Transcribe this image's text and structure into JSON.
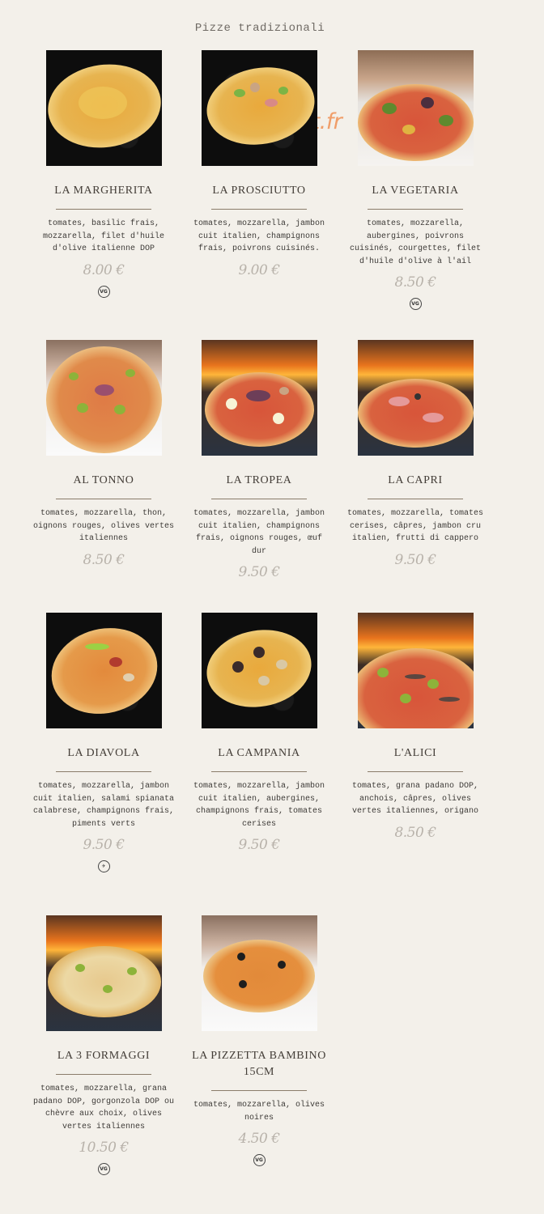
{
  "section_title": "Pizze tradizionali",
  "watermark": "list.fr",
  "pizzas": [
    {
      "name": "La Margherita",
      "description": "tomates, basilic frais, mozzarella, filet d'huile d'olive italienne DOP",
      "price": "8.00 €",
      "badge": "VG"
    },
    {
      "name": "La Prosciutto",
      "description": "tomates, mozzarella, jambon cuit italien, champignons frais, poivrons cuisinés.",
      "price": "9.00 €",
      "badge": ""
    },
    {
      "name": "La Vegetaria",
      "description": "tomates, mozzarella, aubergines, poivrons cuisinés, courgettes, filet d'huile d'olive à l'ail",
      "price": "8.50 €",
      "badge": "VG"
    },
    {
      "name": "Al Tonno",
      "description": "tomates, mozzarella, thon, oignons rouges, olives vertes italiennes",
      "price": "8.50 €",
      "badge": ""
    },
    {
      "name": "La Tropea",
      "description": "tomates, mozzarella, jambon cuit italien, champignons frais, oignons rouges, œuf dur",
      "price": "9.50 €",
      "badge": ""
    },
    {
      "name": "La Capri",
      "description": "tomates, mozzarella, tomates cerises, câpres, jambon cru italien, frutti di cappero",
      "price": "9.50 €",
      "badge": ""
    },
    {
      "name": "La Diavola",
      "description": "tomates, mozzarella, jambon cuit italien, salami spianata calabrese, champignons frais, piments verts",
      "price": "9.50 €",
      "badge": "spicy-icon"
    },
    {
      "name": "La Campania",
      "description": "tomates, mozzarella, jambon cuit italien, aubergines, champignons frais, tomates cerises",
      "price": "9.50 €",
      "badge": ""
    },
    {
      "name": "L'Alici",
      "description": "tomates, grana padano DOP, anchois, câpres, olives vertes italiennes, origano",
      "price": "8.50 €",
      "badge": ""
    },
    {
      "name": "La 3 Formaggi",
      "description": "tomates, mozzarella, grana padano DOP, gorgonzola DOP ou chèvre aux choix, olives vertes italiennes",
      "price": "10.50 €",
      "badge": "VG"
    },
    {
      "name": "La Pizzetta Bambino 15cm",
      "description": "tomates, mozzarella, olives noires",
      "price": "4.50 €",
      "badge": "VG"
    }
  ]
}
